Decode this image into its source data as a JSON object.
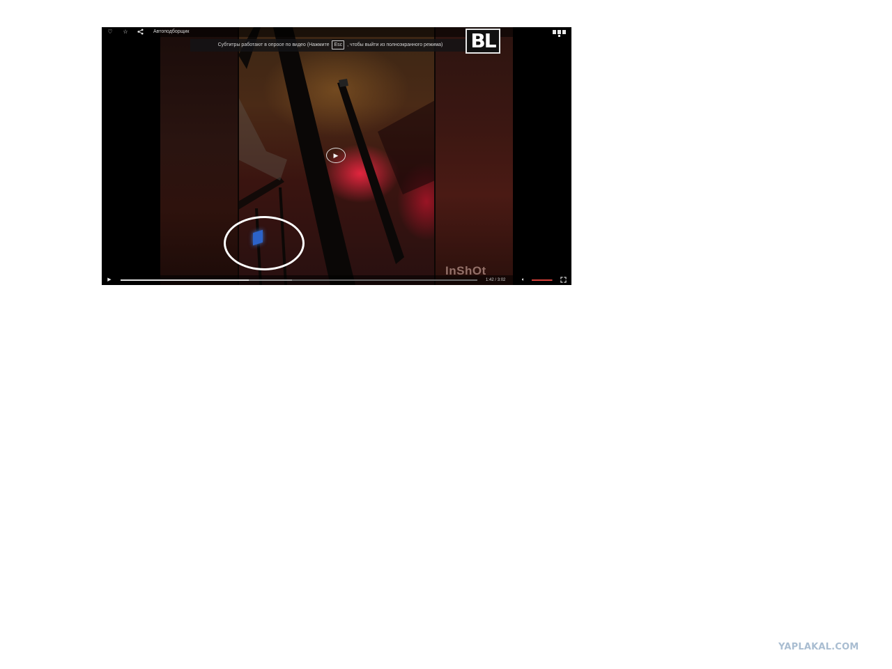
{
  "player": {
    "top_bar": {
      "icons": [
        "heart-icon",
        "star-icon",
        "share-icon"
      ],
      "title": "Автоподборщик"
    },
    "notice": {
      "text_before": "Субтитры работают в опросе по видео (Нажмите",
      "key": "Esc",
      "text_after": ", чтобы выйти из полноэкранного режима)"
    },
    "overlay_logo": "BL",
    "corner_icon": "player-logo-icon",
    "center_play_icon": "play-icon",
    "watermark": "InShOt",
    "controls": {
      "play_icon": "play-icon",
      "progress_played_fraction": 0.36,
      "progress_buffered_fraction": 0.48,
      "current_time": "1:42",
      "separator": "/",
      "duration": "3:02",
      "volume_icon": "volume-icon",
      "volume_level_fraction": 0.95,
      "fullscreen_icon": "fullscreen-icon"
    },
    "colors": {
      "highlight_circle": "#ffffff",
      "volume_accent": "#d8403a"
    }
  },
  "site_watermark": "YAPLAKAL.COM"
}
